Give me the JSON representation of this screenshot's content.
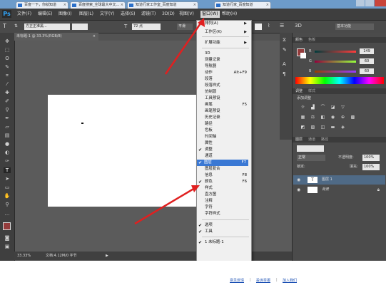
{
  "browser": {
    "tabs": [
      "百度一下，你就知道",
      "百度搜索_全球最大中文...",
      "知道行家工作室_百度知道",
      "知道行家_百度知道"
    ],
    "tab_close": "×"
  },
  "ps": {
    "logo": "Ps",
    "menu": [
      "文件(F)",
      "编辑(E)",
      "图像(I)",
      "图层(L)",
      "文字(Y)",
      "选择(S)",
      "滤镜(T)",
      "3D(D)",
      "视图(V)",
      "窗口(W)",
      "帮助(H)"
    ],
    "options": {
      "font_family": "方正正准黑...",
      "font_size": "72 点",
      "antialias": "平滑",
      "workspace": "基本功能"
    },
    "document_tab": "未标题-1 @ 33.3%(RGB/8)",
    "doc_close": "×",
    "status": {
      "zoom": "33.33%",
      "doc": "文档:4.12M/0 字节"
    },
    "panels": {
      "color_tabs": [
        "颜色",
        "色板"
      ],
      "rgb": [
        {
          "label": "R",
          "value": "149"
        },
        {
          "label": "G",
          "value": "60"
        },
        {
          "label": "B",
          "value": "60"
        }
      ],
      "adjust_tabs": [
        "调整",
        "样式"
      ],
      "adjust_title": "添加调整",
      "layer_tabs": [
        "图层",
        "通道",
        "路径"
      ],
      "blend_mode": "正常",
      "opacity_label": "不透明度:",
      "opacity": "100%",
      "lock_label": "锁定:",
      "fill_label": "填充:",
      "fill": "100%",
      "layers": [
        {
          "name": "图层 1",
          "thumb": "T"
        },
        {
          "name": "背景",
          "thumb": ""
        }
      ]
    },
    "colors": {
      "foreground": "#953c3c",
      "highlight": "#3a78d4"
    }
  },
  "window_menu": {
    "items": [
      {
        "label": "排列(A)",
        "submenu": true
      },
      {
        "label": "工作区(K)",
        "submenu": true
      },
      {
        "label": "扩展功能",
        "submenu": true
      },
      {
        "label": "3D"
      },
      {
        "label": "测量记录"
      },
      {
        "label": "导航器"
      },
      {
        "label": "动作",
        "shortcut": "Alt+F9"
      },
      {
        "label": "段落"
      },
      {
        "label": "段落样式"
      },
      {
        "label": "仿制源"
      },
      {
        "label": "工具预设"
      },
      {
        "label": "画笔",
        "shortcut": "F5"
      },
      {
        "label": "画笔预设"
      },
      {
        "label": "历史记录"
      },
      {
        "label": "路径"
      },
      {
        "label": "色板"
      },
      {
        "label": "时间轴"
      },
      {
        "label": "属性"
      },
      {
        "label": "调整",
        "checked": true
      },
      {
        "label": "通道"
      },
      {
        "label": "图层",
        "shortcut": "F7",
        "checked": true,
        "highlighted": true
      },
      {
        "label": "图层复合"
      },
      {
        "label": "信息",
        "shortcut": "F8"
      },
      {
        "label": "颜色",
        "shortcut": "F6",
        "checked": true
      },
      {
        "label": "样式"
      },
      {
        "label": "直方图"
      },
      {
        "label": "注释"
      },
      {
        "label": "字符"
      },
      {
        "label": "字符样式"
      },
      {
        "label": "选项",
        "checked": true
      },
      {
        "label": "工具",
        "checked": true
      },
      {
        "label": "1 未标题-1",
        "checked": true
      }
    ]
  },
  "footer_links": [
    "意见反馈",
    "投诉举报",
    "加入我们"
  ],
  "footer_sep": "|",
  "icons": {
    "check": "✔",
    "submenu": "▶"
  }
}
